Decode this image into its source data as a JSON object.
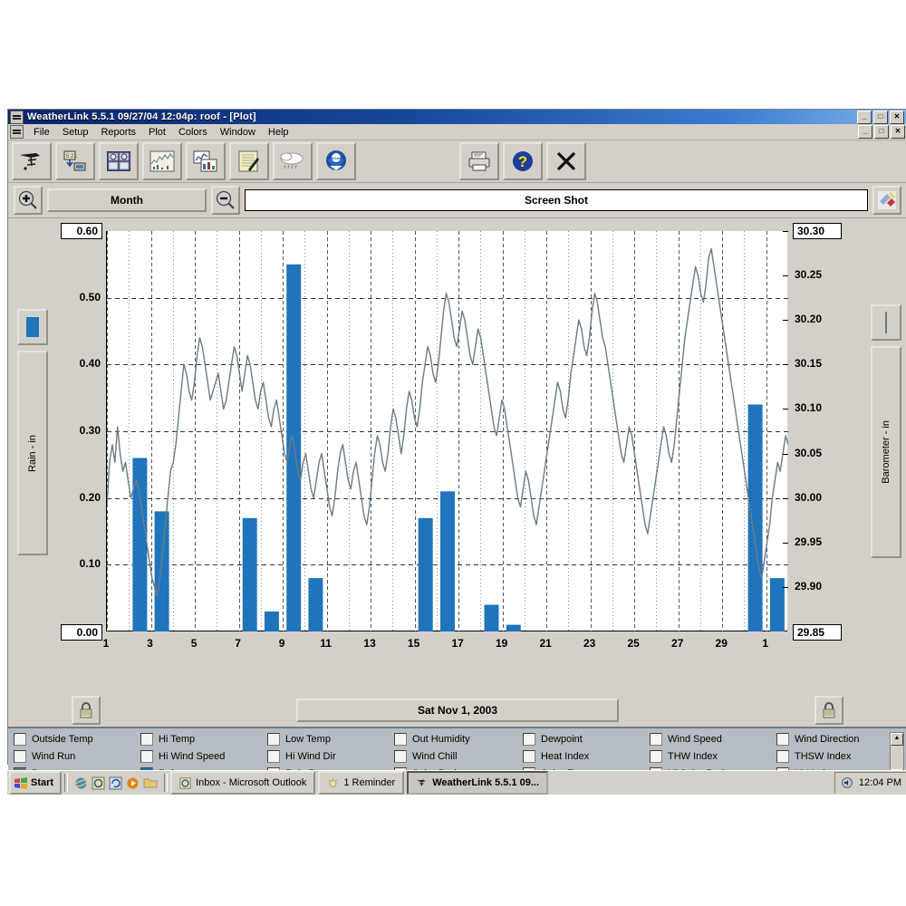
{
  "window": {
    "title": "WeatherLink 5.5.1  09/27/04  12:04p: roof - [Plot]",
    "title_icon": "weather-station-icon",
    "min_label": "_",
    "max_label": "□",
    "close_label": "✕",
    "mdi_min_label": "_",
    "mdi_max_label": "□",
    "mdi_close_label": "✕"
  },
  "menu": {
    "items": [
      {
        "label": "File"
      },
      {
        "label": "Setup"
      },
      {
        "label": "Reports"
      },
      {
        "label": "Plot"
      },
      {
        "label": "Colors"
      },
      {
        "label": "Window"
      },
      {
        "label": "Help"
      }
    ]
  },
  "toolbar": {
    "buttons": [
      {
        "name": "station-icon",
        "tip": "Station"
      },
      {
        "name": "download-icon",
        "tip": "Download"
      },
      {
        "name": "bulletin-icon",
        "tip": "Bulletin"
      },
      {
        "name": "plot-icon",
        "tip": "Plot"
      },
      {
        "name": "report-icon",
        "tip": "Reports"
      },
      {
        "name": "notes-icon",
        "tip": "Notes"
      },
      {
        "name": "storm-icon",
        "tip": "Storm"
      },
      {
        "name": "noaa-icon",
        "tip": "NOAA"
      }
    ],
    "right_buttons": [
      {
        "name": "print-icon",
        "tip": "Print"
      },
      {
        "name": "help-icon",
        "tip": "Help"
      },
      {
        "name": "close-x-icon",
        "tip": "Close"
      }
    ]
  },
  "navbar": {
    "zoom_in_icon": "zoom-in-icon",
    "zoom_out_icon": "zoom-out-icon",
    "span_label": "Month",
    "title_value": "Screen Shot",
    "title_placeholder": "Screen Shot",
    "palette_icon": "color-palette-icon"
  },
  "footer": {
    "date_label": "Sat Nov 1, 2003",
    "lock_left_icon": "padlock-icon",
    "lock_right_icon": "padlock-icon"
  },
  "legend": {
    "columns": [
      [
        {
          "label": "Outside Temp",
          "checked": false,
          "color": "#f4f4f4"
        },
        {
          "label": "Wind Run",
          "checked": false,
          "color": "#f4f4f4"
        },
        {
          "label": "Barometer",
          "checked": true,
          "color": "#6b7b85"
        }
      ],
      [
        {
          "label": "Hi Temp",
          "checked": false,
          "color": "#f4f4f4"
        },
        {
          "label": "Hi Wind Speed",
          "checked": false,
          "color": "#f4f4f4"
        },
        {
          "label": "Rain",
          "checked": true,
          "color": "#1f74bc"
        }
      ],
      [
        {
          "label": "Low Temp",
          "checked": false,
          "color": "#f4f4f4"
        },
        {
          "label": "Hi Wind Dir",
          "checked": false,
          "color": "#f4f4f4"
        },
        {
          "label": "Rain Rate",
          "checked": false,
          "color": "#f4f4f4"
        }
      ],
      [
        {
          "label": "Out Humidity",
          "checked": false,
          "color": "#f4f4f4"
        },
        {
          "label": "Wind Chill",
          "checked": false,
          "color": "#f4f4f4"
        },
        {
          "label": "Solar Rad",
          "checked": false,
          "color": "#f4f4f4"
        }
      ],
      [
        {
          "label": "Dewpoint",
          "checked": false,
          "color": "#f4f4f4"
        },
        {
          "label": "Heat Index",
          "checked": false,
          "color": "#f4f4f4"
        },
        {
          "label": "Solar Energy",
          "checked": false,
          "color": "#f4f4f4"
        }
      ],
      [
        {
          "label": "Wind Speed",
          "checked": false,
          "color": "#f4f4f4"
        },
        {
          "label": "THW Index",
          "checked": false,
          "color": "#f4f4f4"
        },
        {
          "label": "Hi Solar Rad",
          "checked": false,
          "color": "#f4f4f4"
        }
      ],
      [
        {
          "label": "Wind Direction",
          "checked": false,
          "color": "#f4f4f4"
        },
        {
          "label": "THSW Index",
          "checked": false,
          "color": "#f4f4f4"
        },
        {
          "label": "UV Index",
          "checked": false,
          "color": "#f4f4f4"
        }
      ]
    ],
    "scroll_up": "▲",
    "scroll_down": "▼"
  },
  "taskbar": {
    "start_label": "Start",
    "quick_launch": [
      "ie-icon",
      "outlook-icon",
      "update-icon",
      "media-icon",
      "folder-icon"
    ],
    "tasks": [
      {
        "label": "Inbox - Microsoft Outlook",
        "icon": "outlook-icon",
        "active": false
      },
      {
        "label": "1 Reminder",
        "icon": "reminder-icon",
        "active": false
      },
      {
        "label": "WeatherLink 5.5.1  09...",
        "icon": "weatherlink-icon",
        "active": true
      }
    ],
    "clock": "12:04 PM",
    "tray_icon": "volume-icon"
  },
  "chart_data": {
    "type": "bar",
    "title": "Screen Shot",
    "xlabel": "",
    "ylabel": "Rain - in",
    "y2label": "Barometer - in",
    "x_start_label": "Sat Nov 1, 2003",
    "grid": true,
    "legend_position": "bottom",
    "left_axis": {
      "label": "Rain - in",
      "color": "#1f74bc",
      "ylim": [
        0.0,
        0.6
      ],
      "ticks": [
        "0.00",
        "0.10",
        "0.20",
        "0.30",
        "0.40",
        "0.50",
        "0.60"
      ],
      "min_box": "0.00",
      "max_box": "0.60"
    },
    "right_axis": {
      "label": "Barometer - in",
      "color": "#6b7b85",
      "ylim": [
        29.85,
        30.3
      ],
      "ticks": [
        "29.85",
        "29.90",
        "29.95",
        "30.00",
        "30.05",
        "30.10",
        "30.15",
        "30.20",
        "30.25",
        "30.30"
      ],
      "min_box": "29.85",
      "max_box": "30.30"
    },
    "x_ticks": [
      "1",
      "3",
      "5",
      "7",
      "9",
      "11",
      "13",
      "15",
      "17",
      "19",
      "21",
      "23",
      "25",
      "27",
      "29",
      "1"
    ],
    "x_days": 31,
    "series": [
      {
        "name": "Rain",
        "type": "bar",
        "axis": "left",
        "color": "#1f74bc",
        "unit": "in",
        "categories": [
          "1",
          "2",
          "3",
          "4",
          "5",
          "6",
          "7",
          "8",
          "9",
          "10",
          "11",
          "12",
          "13",
          "14",
          "15",
          "16",
          "17",
          "18",
          "19",
          "20",
          "21",
          "22",
          "23",
          "24",
          "25",
          "26",
          "27",
          "28",
          "29",
          "30",
          "31"
        ],
        "values": [
          0,
          0.26,
          0.18,
          0,
          0,
          0,
          0.17,
          0.03,
          0.55,
          0.08,
          0,
          0,
          0,
          0,
          0.17,
          0.21,
          0,
          0.04,
          0.01,
          0,
          0,
          0,
          0,
          0,
          0,
          0,
          0,
          0,
          0,
          0.34,
          0.08
        ]
      },
      {
        "name": "Barometer",
        "type": "line",
        "axis": "right",
        "color": "#6b7b85",
        "unit": "in",
        "sample_interval": "30 min",
        "values": [
          29.99,
          30.04,
          30.06,
          30.04,
          30.08,
          30.05,
          30.03,
          30.04,
          30.02,
          30.0,
          30.01,
          30.02,
          30.01,
          29.99,
          29.97,
          29.95,
          29.93,
          29.91,
          29.9,
          29.89,
          29.91,
          29.94,
          29.97,
          30.0,
          30.03,
          30.04,
          30.06,
          30.09,
          30.12,
          30.15,
          30.14,
          30.12,
          30.11,
          30.13,
          30.16,
          30.18,
          30.17,
          30.15,
          30.13,
          30.11,
          30.12,
          30.13,
          30.14,
          30.12,
          30.1,
          30.11,
          30.13,
          30.15,
          30.17,
          30.16,
          30.14,
          30.12,
          30.14,
          30.16,
          30.15,
          30.13,
          30.11,
          30.1,
          30.12,
          30.13,
          30.11,
          30.09,
          30.08,
          30.1,
          30.11,
          30.09,
          30.07,
          30.05,
          30.04,
          30.06,
          30.07,
          30.05,
          30.03,
          30.02,
          30.04,
          30.05,
          30.03,
          30.01,
          30.0,
          30.02,
          30.04,
          30.05,
          30.03,
          30.01,
          29.99,
          29.98,
          30.0,
          30.03,
          30.05,
          30.06,
          30.04,
          30.02,
          30.01,
          30.03,
          30.04,
          30.02,
          30.0,
          29.98,
          29.97,
          29.99,
          30.02,
          30.05,
          30.07,
          30.06,
          30.04,
          30.03,
          30.05,
          30.08,
          30.1,
          30.09,
          30.07,
          30.05,
          30.07,
          30.1,
          30.12,
          30.11,
          30.09,
          30.08,
          30.1,
          30.13,
          30.15,
          30.17,
          30.16,
          30.14,
          30.13,
          30.15,
          30.18,
          30.21,
          30.23,
          30.22,
          30.2,
          30.18,
          30.17,
          30.19,
          30.21,
          30.2,
          30.18,
          30.16,
          30.15,
          30.17,
          30.19,
          30.18,
          30.16,
          30.14,
          30.12,
          30.1,
          30.08,
          30.07,
          30.09,
          30.11,
          30.1,
          30.08,
          30.06,
          30.04,
          30.02,
          30.0,
          29.99,
          30.01,
          30.03,
          30.02,
          30.0,
          29.98,
          29.97,
          29.99,
          30.01,
          30.03,
          30.05,
          30.07,
          30.09,
          30.11,
          30.13,
          30.12,
          30.1,
          30.09,
          30.11,
          30.14,
          30.16,
          30.18,
          30.2,
          30.19,
          30.17,
          30.16,
          30.18,
          30.21,
          30.23,
          30.22,
          30.2,
          30.18,
          30.17,
          30.15,
          30.13,
          30.11,
          30.09,
          30.07,
          30.05,
          30.04,
          30.06,
          30.08,
          30.07,
          30.05,
          30.03,
          30.01,
          29.99,
          29.97,
          29.96,
          29.98,
          30.0,
          30.02,
          30.04,
          30.06,
          30.08,
          30.07,
          30.05,
          30.04,
          30.06,
          30.09,
          30.12,
          30.15,
          30.18,
          30.2,
          30.22,
          30.24,
          30.26,
          30.25,
          30.23,
          30.22,
          30.24,
          30.27,
          30.28,
          30.26,
          30.24,
          30.22,
          30.2,
          30.18,
          30.16,
          30.14,
          30.12,
          30.1,
          30.08,
          30.06,
          30.04,
          30.02,
          30.0,
          29.98,
          29.96,
          29.94,
          29.92,
          29.91,
          29.93,
          29.95,
          29.97,
          30.0,
          30.02,
          30.04,
          30.03,
          30.05,
          30.07,
          30.06
        ]
      }
    ]
  }
}
